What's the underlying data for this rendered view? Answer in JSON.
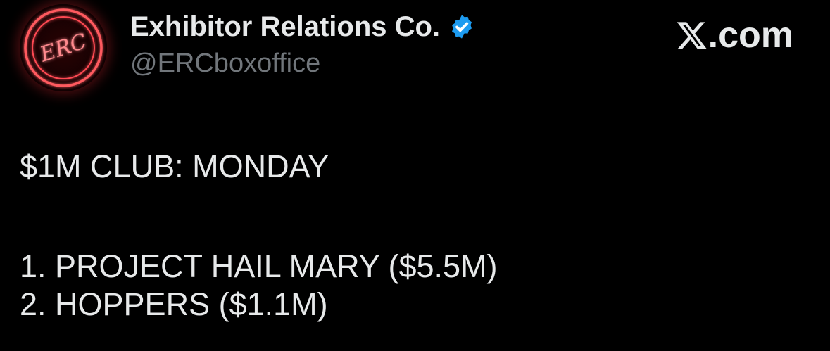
{
  "author": {
    "display_name": "Exhibitor Relations Co.",
    "handle": "@ERCboxoffice",
    "verified": true,
    "verified_color": "#1d9bf0",
    "avatar_text": "ERC",
    "avatar_color": "#e8343c"
  },
  "brand": {
    "icon": "x-logo-icon",
    "text": ".com"
  },
  "tweet": {
    "heading": "$1M CLUB: MONDAY",
    "items": [
      "1. PROJECT HAIL MARY ($5.5M)",
      "2. HOPPERS ($1.1M)"
    ]
  },
  "colors": {
    "background": "#000000",
    "text": "#e7e9ea",
    "muted": "#71767b"
  }
}
